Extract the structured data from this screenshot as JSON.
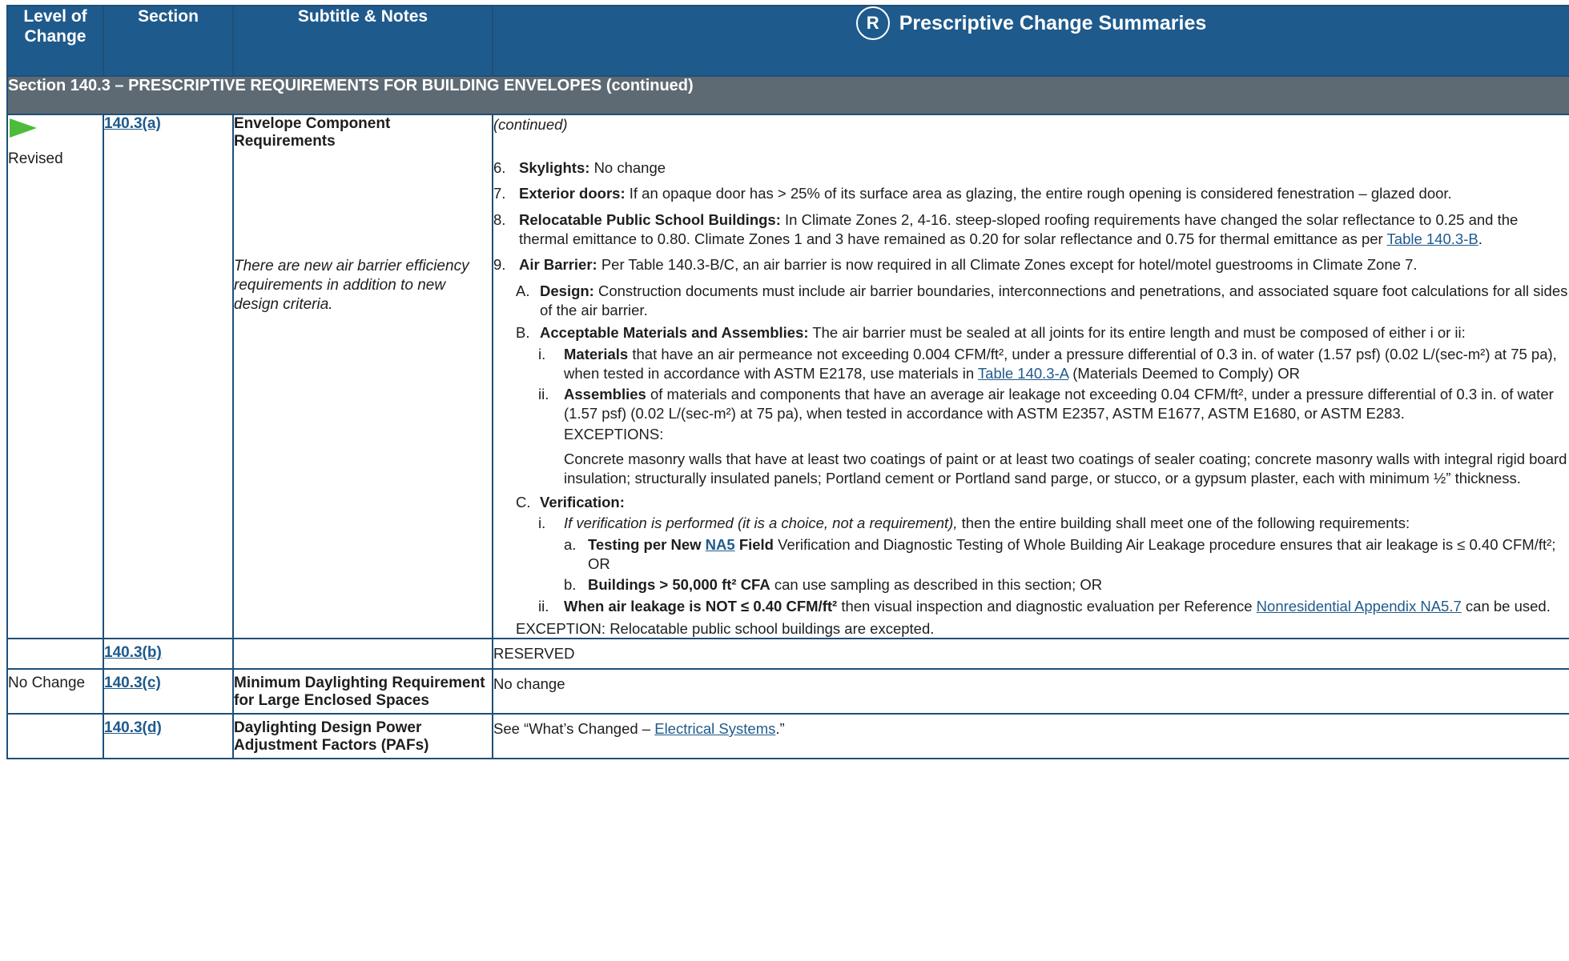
{
  "header": {
    "level": "Level of Change",
    "section": "Section",
    "subtitle": "Subtitle & Notes",
    "summaries": "Prescriptive Change Summaries",
    "summaries_icon": "R"
  },
  "section_title": "Section 140.3 – PRESCRIPTIVE REQUIREMENTS FOR BUILDING ENVELOPES (continued)",
  "rows": [
    {
      "level": "Revised",
      "section": "140.3(a)",
      "subtitle": "Envelope Component Requirements",
      "note": "There are new air barrier efficiency requirements in addition to new design criteria.",
      "continued": "(continued)",
      "items": {
        "i6_num": "6.",
        "i6_b": "Skylights:",
        "i6_t": "No change",
        "i7_num": "7.",
        "i7_b": "Exterior doors:",
        "i7_t": "If an opaque door has > 25% of its surface area as glazing, the entire rough opening is considered fenestration – glazed door.",
        "i8_num": "8.",
        "i8_b": "Relocatable Public School Buildings:",
        "i8_t": "In Climate Zones 2, 4-16. steep-sloped roofing requirements have changed the solar reflectance to 0.25 and the thermal emittance to 0.80. Climate Zones 1 and 3 have remained as 0.20 for solar reflectance and 0.75 for thermal emittance as per",
        "i8_link": "Table 140.3-B",
        "i8_end": ".",
        "i9_num": "9.",
        "i9_b": "Air Barrier:",
        "i9_t": "Per Table 140.3-B/C, an air barrier is now required in all Climate Zones except for hotel/motel guestrooms in Climate Zone 7.",
        "A_num": "A.",
        "A_b": "Design:",
        "A_t": "Construction documents must include air barrier boundaries, interconnections and penetrations, and associated square foot calculations for all sides of the air barrier.",
        "B_num": "B.",
        "B_b": "Acceptable Materials and Assemblies:",
        "B_t": "The air barrier must be sealed at all joints for its entire length and must be composed of either i or ii:",
        "Bi_num": "i.",
        "Bi_b": "Materials",
        "Bi_t": "that have an air permeance not exceeding 0.004 CFM/ft², under a pressure differential of 0.3 in. of water (1.57 psf) (0.02 L/(sec-m²) at 75 pa), when tested in accordance with ASTM E2178, use materials in",
        "Bi_link": "Table 140.3-A",
        "Bi_end": "(Materials Deemed to Comply) OR",
        "Bii_num": "ii.",
        "Bii_b": "Assemblies",
        "Bii_t": "of materials and components that have an average air leakage not exceeding 0.04 CFM/ft², under a pressure differential of 0.3 in. of water (1.57 psf) (0.02 L/(sec-m²) at 75 pa), when tested in accordance with ASTM E2357, ASTM E1677, ASTM E1680, or ASTM E283.",
        "exc_label": "EXCEPTIONS:",
        "exc_text": "Concrete masonry walls that have at least two coatings of paint or at least two coatings of sealer coating; concrete masonry walls with integral rigid board insulation; structurally insulated panels; Portland cement or Portland sand parge, or stucco, or a gypsum plaster, each with minimum ½” thickness.",
        "C_num": "C.",
        "C_b": "Verification:",
        "Ci_num": "i.",
        "Ci_i": "If verification is performed (it is a choice, not a requirement),",
        "Ci_t": "then the entire building shall meet one of the following requirements:",
        "Cia_num": "a.",
        "Cia_b1": "Testing per New",
        "Cia_link": "NA5",
        "Cia_b2": "Field",
        "Cia_t": "Verification and Diagnostic Testing of Whole Building Air Leakage procedure ensures that air leakage is ≤ 0.40 CFM/ft²; OR",
        "Cib_num": "b.",
        "Cib_b": "Buildings > 50,000 ft² CFA",
        "Cib_t": "can use sampling as described in this section; OR",
        "Cii_num": "ii.",
        "Cii_b": "When air leakage is NOT ≤ 0.40 CFM/ft²",
        "Cii_t": "then visual inspection and diagnostic evaluation per Reference",
        "Cii_link": "Nonresidential Appendix NA5.7",
        "Cii_end": "can be used.",
        "exception_final": "EXCEPTION: Relocatable public school buildings are excepted."
      }
    },
    {
      "level": "",
      "section": "140.3(b)",
      "subtitle": "",
      "summary": "RESERVED"
    },
    {
      "level": "No Change",
      "section": "140.3(c)",
      "subtitle": "Minimum Daylighting Requirement for Large Enclosed Spaces",
      "summary": "No change"
    },
    {
      "level": "",
      "section": "140.3(d)",
      "subtitle": "Daylighting Design Power Adjustment Factors (PAFs)",
      "summary_pre": "See “What’s Changed –",
      "summary_link": "Electrical Systems",
      "summary_post": ".”"
    }
  ],
  "colors": {
    "header_bg": "#1f5a8c",
    "section_bg": "#5e6a73",
    "link": "#1f5a8c",
    "arrow": "#4cbc3a"
  },
  "icons": {
    "level_revised": "green-arrow-icon",
    "summaries": "prescription-icon"
  }
}
